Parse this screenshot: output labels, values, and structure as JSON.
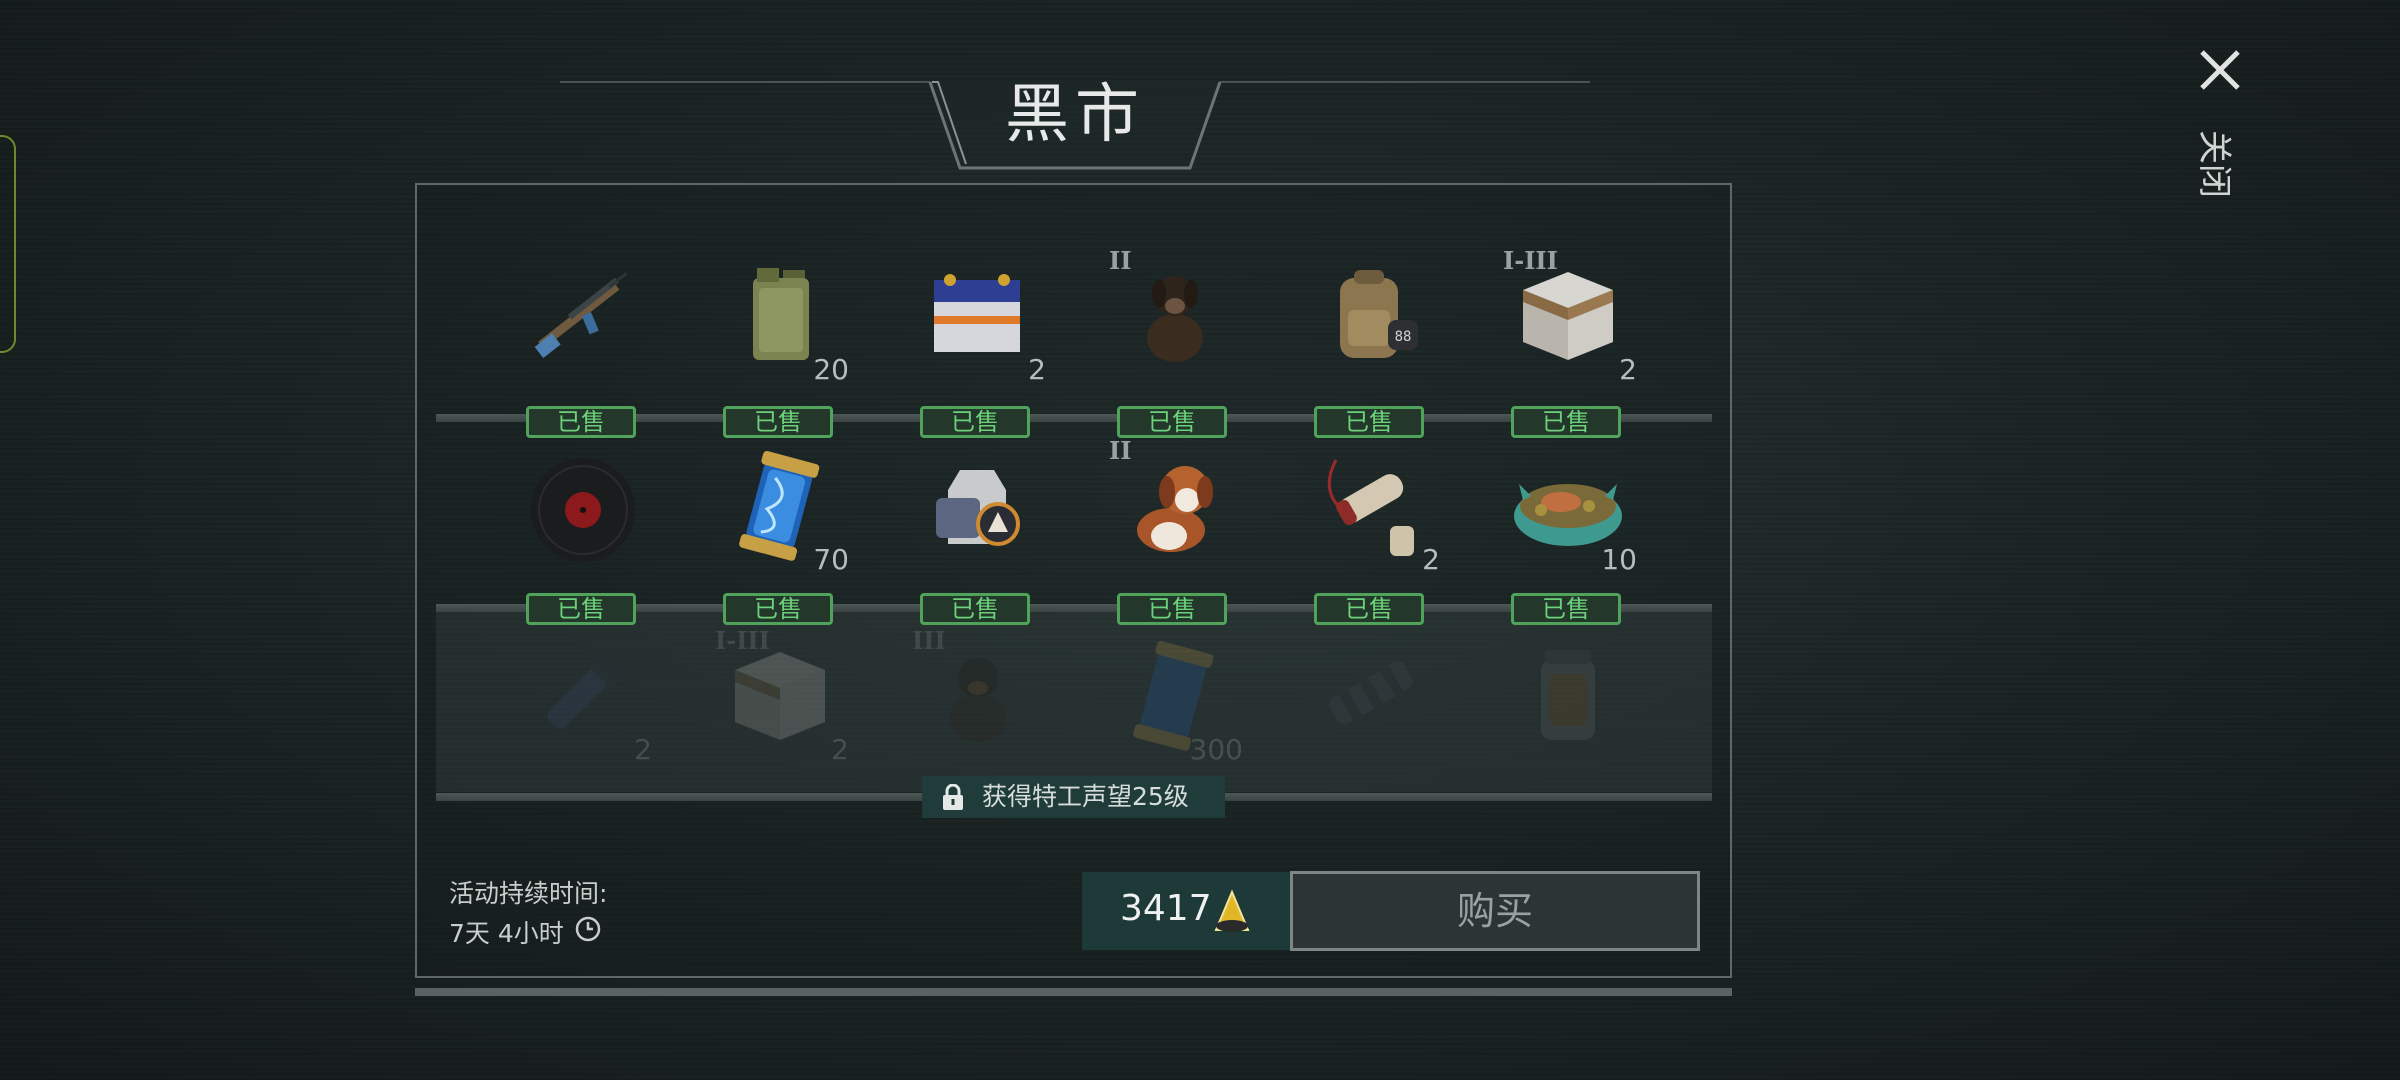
{
  "title": "黑市",
  "close_label": "关闭",
  "sold_label": "已售",
  "rows": [
    {
      "items": [
        {
          "name": "assault-rifle-icon",
          "qty": "",
          "tier": ""
        },
        {
          "name": "fuel-canister-icon",
          "qty": "20",
          "tier": ""
        },
        {
          "name": "car-battery-icon",
          "qty": "2",
          "tier": ""
        },
        {
          "name": "puppy-dog-icon",
          "qty": "",
          "tier": "II"
        },
        {
          "name": "backpack-icon",
          "qty": "",
          "tier": ""
        },
        {
          "name": "supply-crate-icon",
          "qty": "2",
          "tier": "I-III"
        }
      ]
    },
    {
      "items": [
        {
          "name": "vinyl-record-icon",
          "qty": "",
          "tier": ""
        },
        {
          "name": "dna-capsule-icon",
          "qty": "70",
          "tier": ""
        },
        {
          "name": "armor-vest-icon",
          "qty": "",
          "tier": ""
        },
        {
          "name": "saint-bernard-puppy-icon",
          "qty": "",
          "tier": "II"
        },
        {
          "name": "scroll-tube-icon",
          "qty": "2",
          "tier": ""
        },
        {
          "name": "food-bowl-icon",
          "qty": "10",
          "tier": ""
        }
      ]
    },
    {
      "locked": true,
      "items": [
        {
          "name": "flashlight-icon",
          "qty": "2",
          "tier": ""
        },
        {
          "name": "supply-crate-icon",
          "qty": "2",
          "tier": "I-III"
        },
        {
          "name": "rottweiler-puppy-icon",
          "qty": "",
          "tier": "III"
        },
        {
          "name": "dna-capsule-icon",
          "qty": "300",
          "tier": ""
        },
        {
          "name": "engine-part-icon",
          "qty": "",
          "tier": ""
        },
        {
          "name": "jar-icon",
          "qty": "",
          "tier": ""
        }
      ]
    }
  ],
  "lock_requirement": "获得特工声望25级",
  "duration": {
    "label": "活动持续时间:",
    "value": "7天 4小时"
  },
  "price": "3417",
  "buy_label": "购买",
  "colors": {
    "sold_green": "#4fa35a",
    "price_bg": "#1d3a39",
    "panel_border": "#5e6867"
  }
}
